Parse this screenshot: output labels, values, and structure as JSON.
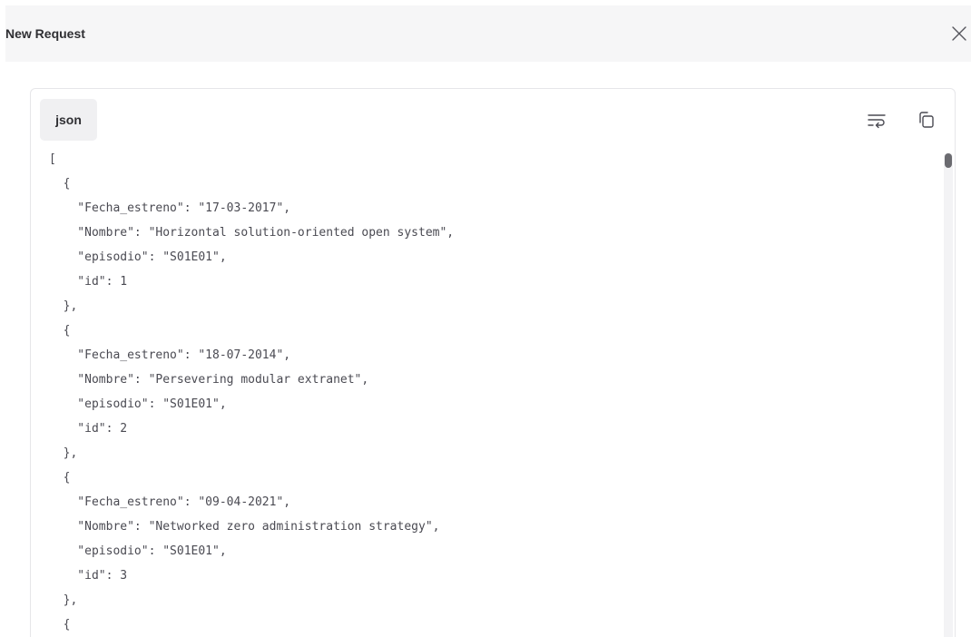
{
  "dialog": {
    "title": "New Request",
    "close_icon": "close-icon"
  },
  "code_block": {
    "language": "json",
    "wrap_icon": "wrap-text-icon",
    "copy_icon": "copy-icon",
    "lines": [
      "[",
      "  {",
      "    \"Fecha_estreno\": \"17-03-2017\",",
      "    \"Nombre\": \"Horizontal solution-oriented open system\",",
      "    \"episodio\": \"S01E01\",",
      "    \"id\": 1",
      "  },",
      "  {",
      "    \"Fecha_estreno\": \"18-07-2014\",",
      "    \"Nombre\": \"Persevering modular extranet\",",
      "    \"episodio\": \"S01E01\",",
      "    \"id\": 2",
      "  },",
      "  {",
      "    \"Fecha_estreno\": \"09-04-2021\",",
      "    \"Nombre\": \"Networked zero administration strategy\",",
      "    \"episodio\": \"S01E01\",",
      "    \"id\": 3",
      "  },",
      "  {"
    ]
  }
}
